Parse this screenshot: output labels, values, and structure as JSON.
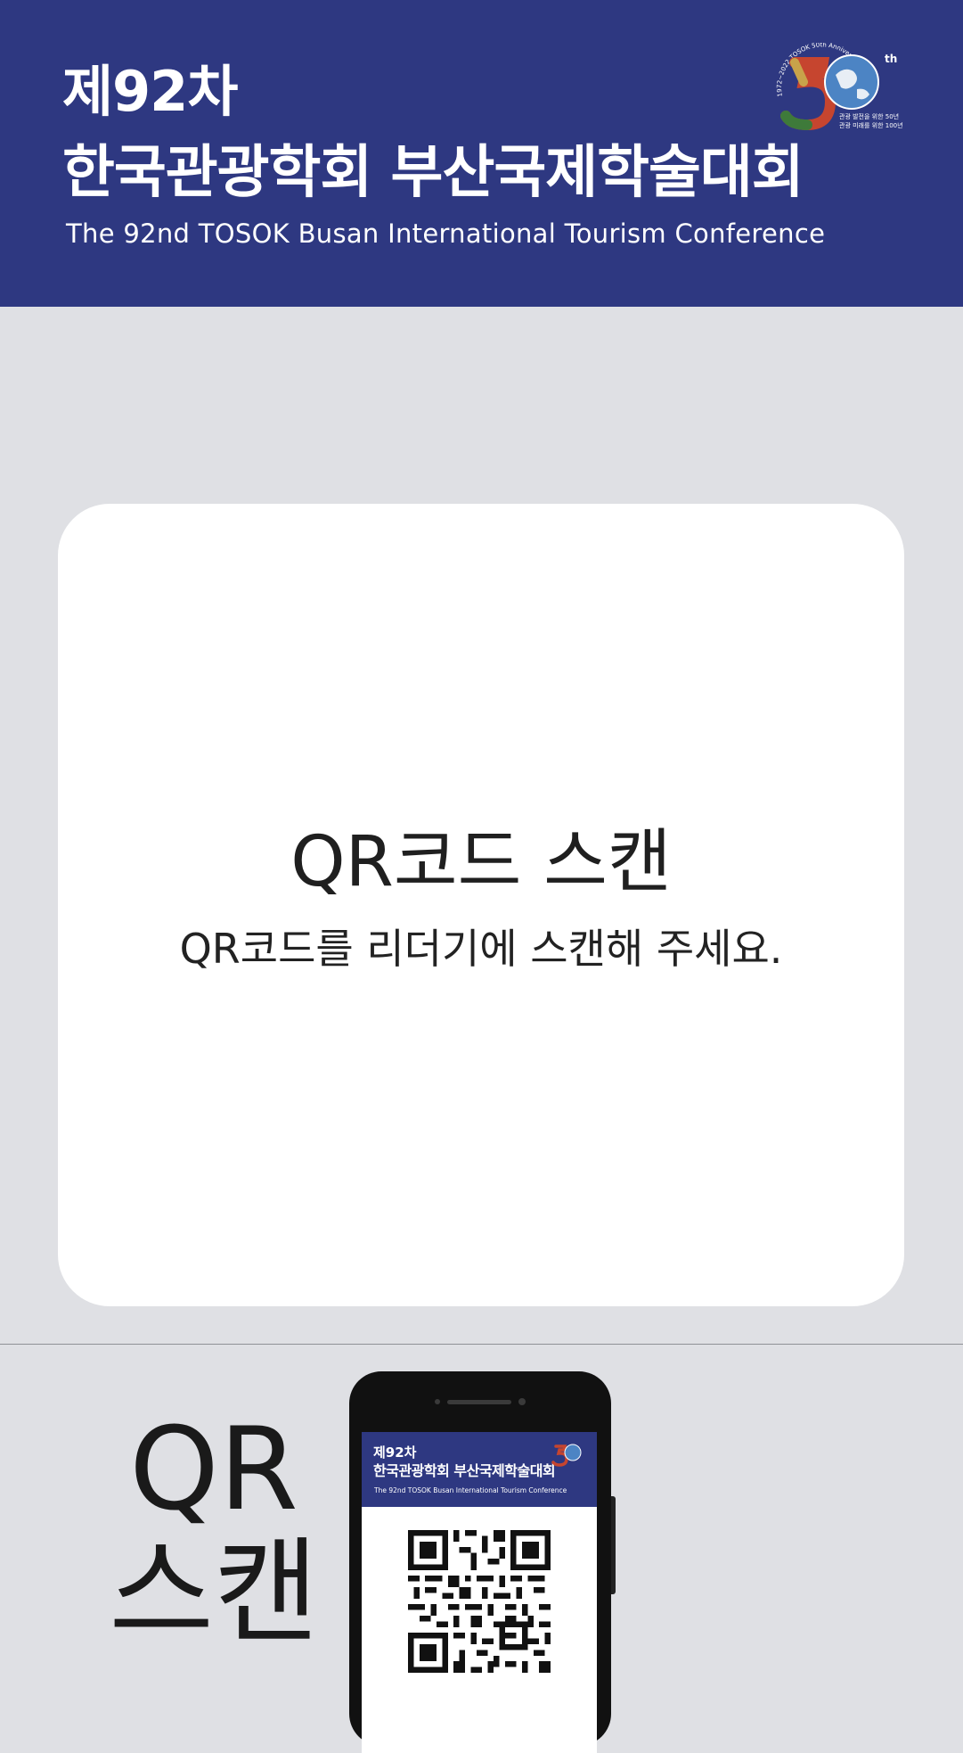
{
  "header": {
    "edition": "제92차",
    "title_ko": "한국관광학회 부산국제학술대회",
    "title_en": "The 92nd TOSOK Busan International Tourism Conference",
    "logo": {
      "ring_text": "1972~2022 TOSOK 50th Anniversary",
      "numeral": "5",
      "superscript": "th",
      "tagline_1": "관광 발전을 위한 50년",
      "tagline_2": "관광 미래를 위한 100년"
    }
  },
  "scan_card": {
    "title": "QR코드 스캔",
    "subtitle": "QR코드를 리더기에 스캔해 주세요."
  },
  "footer": {
    "big_label_1": "QR",
    "big_label_2": "스캔"
  },
  "phone_screen": {
    "edition": "제92차",
    "title_ko": "한국관광학회 부산국제학술대회",
    "title_en": "The 92nd TOSOK Busan International Tourism Conference"
  },
  "colors": {
    "header_bg": "#2e3881",
    "page_bg": "#dfe0e4",
    "card_bg": "#ffffff",
    "logo_red": "#c6452f",
    "logo_green": "#3e7a3a",
    "logo_gold": "#c8a34a",
    "logo_globe": "#4c84c4"
  }
}
